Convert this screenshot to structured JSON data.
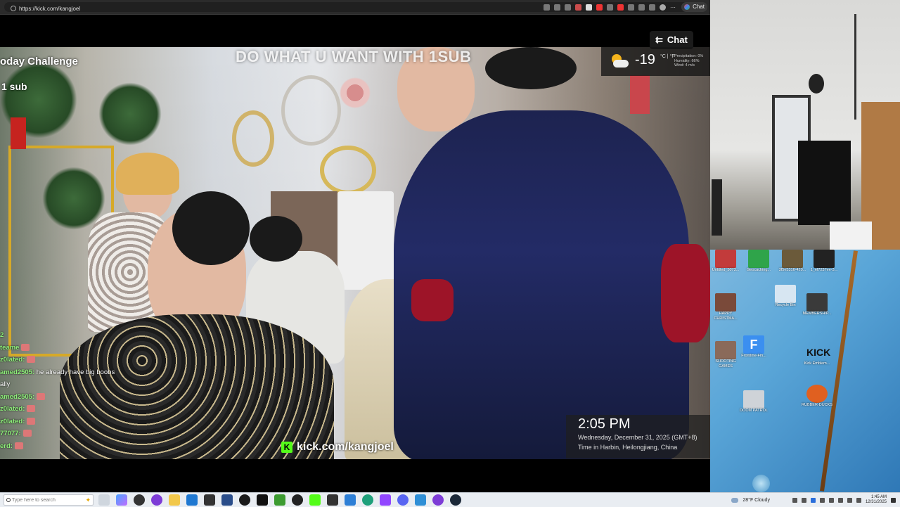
{
  "browser": {
    "url": "https://kick.com/kangjoel",
    "chat_pill": "Chat"
  },
  "stream": {
    "chat_button": "Chat",
    "overlay_title": "oday Challenge",
    "overlay_sub": "1 sub",
    "overlay_banner": "DO WHAT U WANT WITH 1SUB",
    "weather": {
      "temp": "-19",
      "unit": "°C | °F",
      "precipitation": "Precipitation: 0%",
      "humidity": "Humidity: 66%",
      "wind": "Wind: 4 m/s"
    },
    "clock": {
      "time": "2:05 PM",
      "date": "Wednesday, December 31, 2025 (GMT+8)",
      "place": "Time in Harbin, Heilongjiang, China"
    },
    "kick_link": "kick.com/kangjoel",
    "kick_logo": "K",
    "chat_messages": [
      {
        "user": "2",
        "msg": ""
      },
      {
        "user": "teame",
        "msg": ""
      },
      {
        "user": "z0lated:",
        "msg": ""
      },
      {
        "user": "amed2505:",
        "msg": "he already have big boobs"
      },
      {
        "user": "ally",
        "msg": ""
      },
      {
        "user": "amed2505:",
        "msg": ""
      },
      {
        "user": "z0lated:",
        "msg": ""
      },
      {
        "user": "z0lated:",
        "msg": ""
      },
      {
        "user": "77077:",
        "msg": ""
      },
      {
        "user": "erd:",
        "msg": ""
      }
    ]
  },
  "desktop": {
    "icons": [
      {
        "label": "Untitled_5073...",
        "color": "#c23b3b"
      },
      {
        "label": "Geocaching...",
        "color": "#2fa44a"
      },
      {
        "label": "3f5e5316-420...",
        "color": "#6b5a3a"
      },
      {
        "label": "1_ef7237ee-3...",
        "color": "#222222"
      },
      {
        "label": "HAPPY CHRISTMA...",
        "color": "#7a4a3a"
      },
      {
        "label": "Recycle Bin",
        "color": "#d7e6f2"
      },
      {
        "label": "MEMBERSHIP...",
        "color": "#3a3a3a"
      },
      {
        "label": "SHOOTING GAMES",
        "color": "#8a6a5a"
      },
      {
        "label": "Frontline-Fin...",
        "color": "#3b8ff0"
      },
      {
        "label": "Kick Emblem...",
        "color": "#111111"
      },
      {
        "label": "DOOM PATROL",
        "color": "#cfd3d8"
      },
      {
        "label": "RUBBER-DUCKS",
        "color": "#e06020"
      }
    ]
  },
  "taskbar": {
    "search_placeholder": "Type here to search",
    "weather": "28°F  Cloudy",
    "time": "1:45 AM",
    "date": "12/31/2025",
    "apps": [
      "task-view",
      "copilot",
      "cortana",
      "obs",
      "file-explorer",
      "edge",
      "store",
      "settings",
      "steam",
      "terminal",
      "nvidia",
      "chrome",
      "kick",
      "calculator",
      "notepad",
      "edge-dev",
      "twitch",
      "discord",
      "photos",
      "obs-studio",
      "steam-client"
    ]
  }
}
